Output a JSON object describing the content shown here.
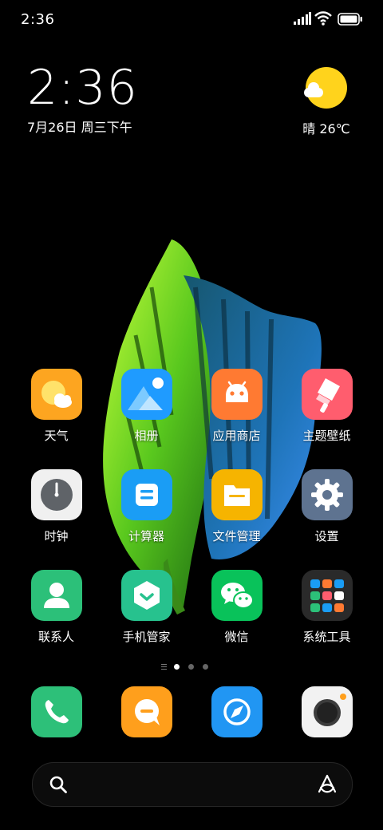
{
  "status_bar": {
    "time": "2:36",
    "icons": [
      "signal-icon",
      "wifi-icon",
      "battery-icon"
    ]
  },
  "clock_widget": {
    "time": "2:36",
    "date": "7月26日 周三下午"
  },
  "weather_widget": {
    "icon": "sunny-cloud-icon",
    "text": "晴 26℃"
  },
  "home_apps": [
    {
      "label": "天气",
      "icon": "weather-icon",
      "color": "#fda520"
    },
    {
      "label": "相册",
      "icon": "gallery-icon",
      "color": "#1f9bff"
    },
    {
      "label": "应用商店",
      "icon": "app-store-icon",
      "color": "#ff7a32"
    },
    {
      "label": "主题壁纸",
      "icon": "theme-icon",
      "color": "#ff5d6e"
    },
    {
      "label": "时钟",
      "icon": "clock-icon",
      "color": "#f0f0f0"
    },
    {
      "label": "计算器",
      "icon": "calculator-icon",
      "color": "#1a9df5"
    },
    {
      "label": "文件管理",
      "icon": "file-manager-icon",
      "color": "#f6b400"
    },
    {
      "label": "设置",
      "icon": "settings-icon",
      "color": "#5e7390"
    },
    {
      "label": "联系人",
      "icon": "contacts-icon",
      "color": "#2cc079"
    },
    {
      "label": "手机管家",
      "icon": "security-icon",
      "color": "#27c28e"
    },
    {
      "label": "微信",
      "icon": "wechat-icon",
      "color": "#09c25a"
    },
    {
      "label": "系统工具",
      "icon": "system-tools-folder-icon",
      "color": "#2a2a2a"
    }
  ],
  "page_indicator": {
    "pages": 3,
    "current": 1
  },
  "dock": [
    {
      "icon": "phone-icon",
      "color": "#2dc079"
    },
    {
      "icon": "messages-icon",
      "color": "#ff9f1c"
    },
    {
      "icon": "browser-icon",
      "color": "#2196f3"
    },
    {
      "icon": "camera-icon",
      "color": "#f2f2f2"
    }
  ],
  "search_bar": {
    "left_icon": "search-icon",
    "right_icon": "assistant-icon"
  }
}
